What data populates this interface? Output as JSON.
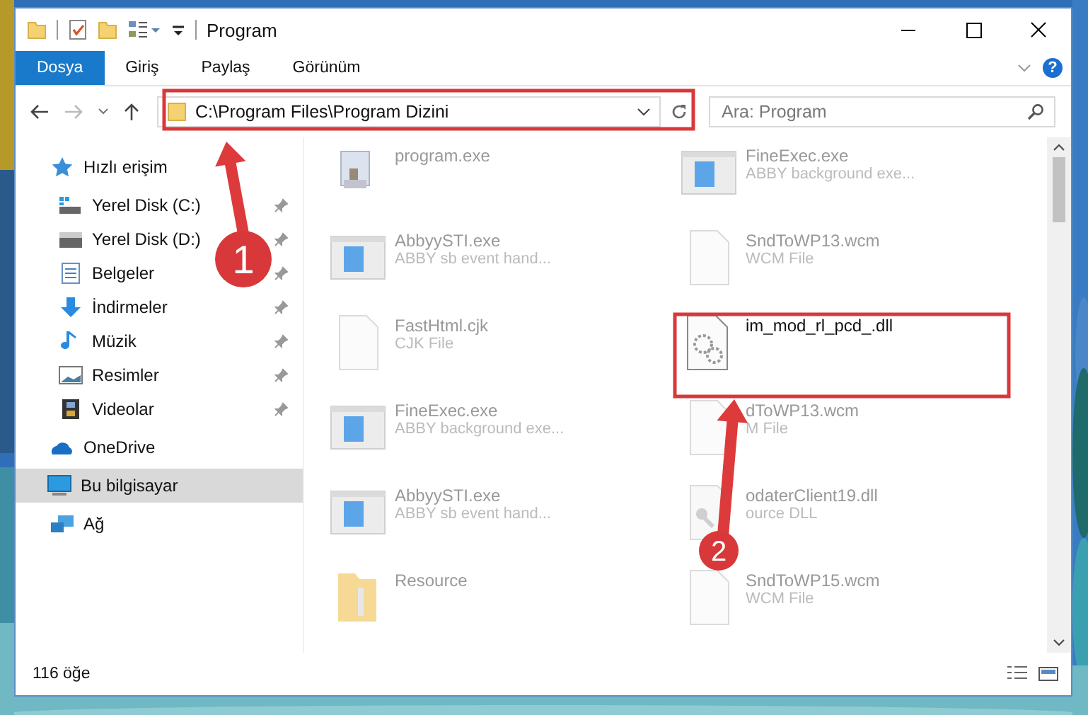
{
  "window": {
    "title": "Program"
  },
  "ribbon": {
    "tabs": [
      {
        "label": "Dosya",
        "selected": true
      },
      {
        "label": "Giriş",
        "selected": false
      },
      {
        "label": "Paylaş",
        "selected": false
      },
      {
        "label": "Görünüm",
        "selected": false
      }
    ],
    "help": "?"
  },
  "nav": {
    "address": "C:\\Program Files\\Program Dizini",
    "search": {
      "placeholder": "Ara: Program"
    }
  },
  "sidebar": {
    "items": [
      {
        "label": "Hızlı erişim",
        "kind": "star",
        "selected": false,
        "children": [
          {
            "label": "Yerel Disk (C:)",
            "kind": "system_drive",
            "pinned": true,
            "selected": false
          },
          {
            "label": "Yerel Disk (D:)",
            "kind": "drive",
            "pinned": true,
            "selected": false
          },
          {
            "label": "Belgeler",
            "kind": "documents",
            "pinned": true,
            "selected": false
          },
          {
            "label": "İndirmeler",
            "kind": "downloads",
            "pinned": true,
            "selected": false
          },
          {
            "label": "Müzik",
            "kind": "music",
            "pinned": true,
            "selected": false
          },
          {
            "label": "Resimler",
            "kind": "pictures",
            "pinned": true,
            "selected": false
          },
          {
            "label": "Videolar",
            "kind": "videos",
            "pinned": true,
            "selected": false
          }
        ]
      },
      {
        "label": "OneDrive",
        "kind": "cloud",
        "selected": false
      },
      {
        "label": "Bu bilgisayar",
        "kind": "computer",
        "selected": true
      },
      {
        "label": "Ağ",
        "kind": "network",
        "selected": false
      }
    ]
  },
  "files": [
    {
      "name": "program.exe",
      "kind": "installer",
      "emphasized": false
    },
    {
      "name": "FineExec.exe",
      "type": "ABBY background exe...",
      "kind": "app",
      "emphasized": false
    },
    {
      "name": "AbbyySTI.exe",
      "type": "ABBY sb event hand...",
      "kind": "app",
      "emphasized": false
    },
    {
      "name": "SndToWP13.wcm",
      "type": "WCM File",
      "kind": "document",
      "emphasized": false
    },
    {
      "name": "FastHtml.cjk",
      "type": "CJK File",
      "kind": "document",
      "emphasized": false
    },
    {
      "name": "im_mod_rl_pcd_.dll",
      "kind": "library",
      "emphasized": true
    },
    {
      "name": "FineExec.exe",
      "type": "ABBY background exe...",
      "kind": "app",
      "emphasized": false
    },
    {
      "name": "dToWP13.wcm",
      "type": "M File",
      "kind": "document",
      "emphasized": false
    },
    {
      "name": "AbbyySTI.exe",
      "type": "ABBY sb event hand...",
      "kind": "app",
      "emphasized": false
    },
    {
      "name": "odaterClient19.dll",
      "type": "ource DLL",
      "kind": "resource",
      "emphasized": false
    },
    {
      "name": "Resource",
      "kind": "folder",
      "emphasized": false
    },
    {
      "name": "SndToWP15.wcm",
      "type": "WCM File",
      "kind": "document",
      "emphasized": false
    }
  ],
  "status_bar": {
    "count": "116 öğe"
  },
  "annotations": [
    {
      "number": "1"
    },
    {
      "number": "2"
    }
  ]
}
